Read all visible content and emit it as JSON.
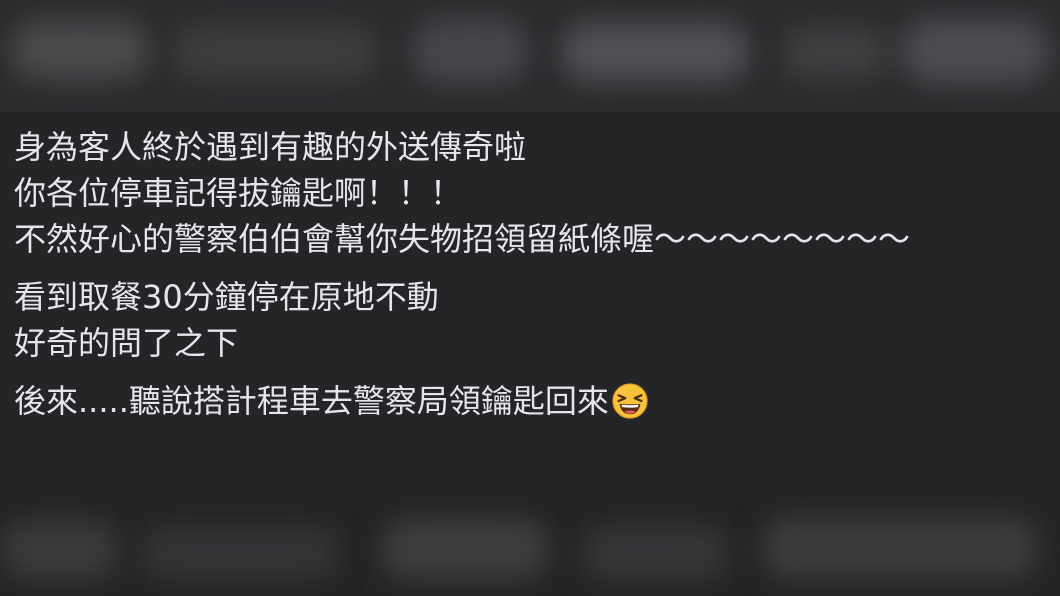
{
  "post": {
    "paragraphs": [
      {
        "lines": [
          "身為客人終於遇到有趣的外送傳奇啦",
          "你各位停車記得拔鑰匙啊！！！",
          "不然好心的警察伯伯會幫你失物招領留紙條喔～～～～～～～～"
        ]
      },
      {
        "lines": [
          "看到取餐30分鐘停在原地不動",
          "好奇的問了之下"
        ]
      },
      {
        "lines": [
          "後來.....聽說搭計程車去警察局領鑰匙回來"
        ]
      }
    ],
    "emoji_icon": "grinning-squinting-face-icon"
  },
  "colors": {
    "background": "#242526",
    "text": "#e4e6eb",
    "emoji_face": "#f7c23c"
  }
}
